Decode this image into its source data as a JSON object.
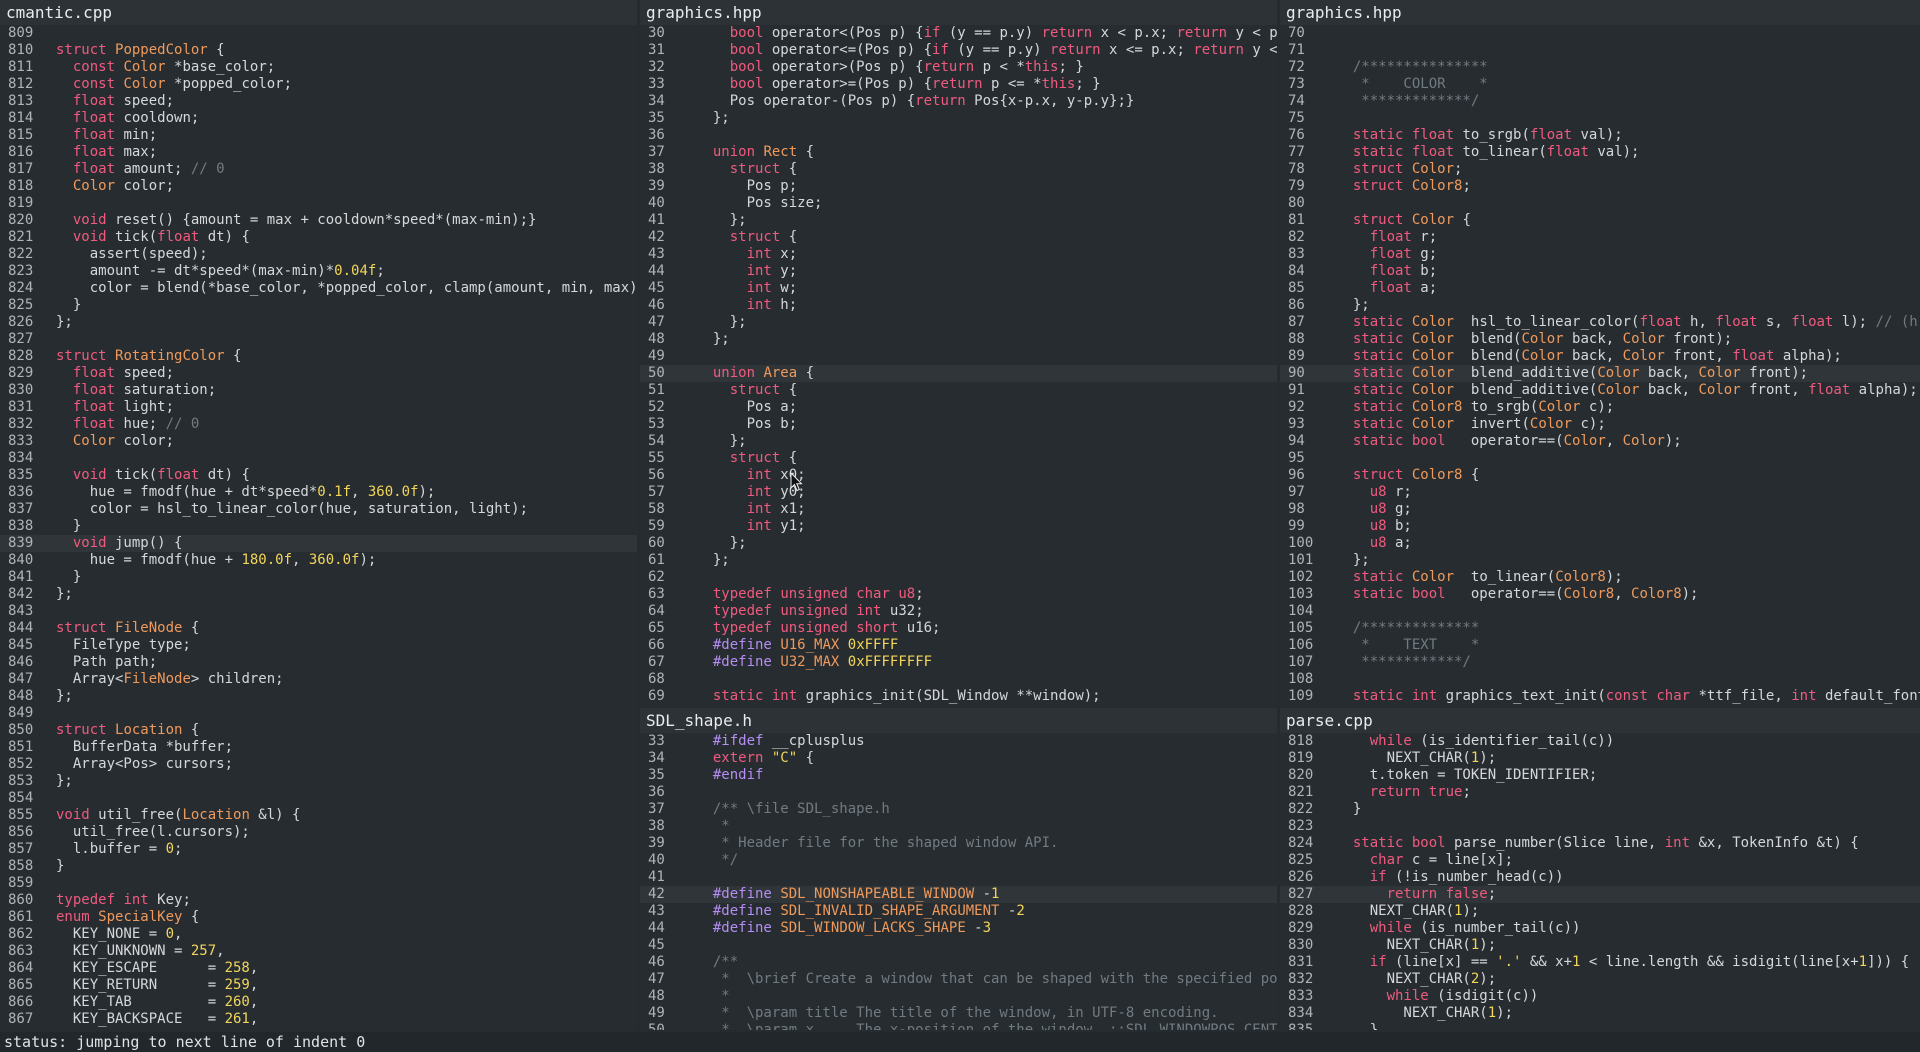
{
  "panes": [
    {
      "id": "left",
      "title": "cmantic.cpp",
      "lnw": 40,
      "lines": [
        {
          "n": "809",
          "t": ""
        },
        {
          "n": "810",
          "t": "struct PoppedColor {"
        },
        {
          "n": "811",
          "t": "  const Color *base_color;"
        },
        {
          "n": "812",
          "t": "  const Color *popped_color;"
        },
        {
          "n": "813",
          "t": "  float speed;"
        },
        {
          "n": "814",
          "t": "  float cooldown;"
        },
        {
          "n": "815",
          "t": "  float min;"
        },
        {
          "n": "816",
          "t": "  float max;"
        },
        {
          "n": "817",
          "t": "  float amount; // 0"
        },
        {
          "n": "818",
          "t": "  Color color;"
        },
        {
          "n": "819",
          "t": ""
        },
        {
          "n": "820",
          "t": "  void reset() {amount = max + cooldown*speed*(max-min);}"
        },
        {
          "n": "821",
          "t": "  void tick(float dt) {"
        },
        {
          "n": "822",
          "t": "    assert(speed);"
        },
        {
          "n": "823",
          "t": "    amount -= dt*speed*(max-min)*0.04f;"
        },
        {
          "n": "824",
          "t": "    color = blend(*base_color, *popped_color, clamp(amount, min, max));"
        },
        {
          "n": "825",
          "t": "  }"
        },
        {
          "n": "826",
          "t": "};"
        },
        {
          "n": "827",
          "t": ""
        },
        {
          "n": "828",
          "t": "struct RotatingColor {"
        },
        {
          "n": "829",
          "t": "  float speed;"
        },
        {
          "n": "830",
          "t": "  float saturation;"
        },
        {
          "n": "831",
          "t": "  float light;"
        },
        {
          "n": "832",
          "t": "  float hue; // 0"
        },
        {
          "n": "833",
          "t": "  Color color;"
        },
        {
          "n": "834",
          "t": ""
        },
        {
          "n": "835",
          "t": "  void tick(float dt) {"
        },
        {
          "n": "836",
          "t": "    hue = fmodf(hue + dt*speed*0.1f, 360.0f);"
        },
        {
          "n": "837",
          "t": "    color = hsl_to_linear_color(hue, saturation, light);"
        },
        {
          "n": "838",
          "t": "  }"
        },
        {
          "n": "839",
          "t": "  void jump() {",
          "hl": true
        },
        {
          "n": "840",
          "t": "    hue = fmodf(hue + 180.0f, 360.0f);"
        },
        {
          "n": "841",
          "t": "  }"
        },
        {
          "n": "842",
          "t": "};"
        },
        {
          "n": "843",
          "t": ""
        },
        {
          "n": "844",
          "t": "struct FileNode {"
        },
        {
          "n": "845",
          "t": "  FileType type;"
        },
        {
          "n": "846",
          "t": "  Path path;"
        },
        {
          "n": "847",
          "t": "  Array<FileNode> children;"
        },
        {
          "n": "848",
          "t": "};"
        },
        {
          "n": "849",
          "t": ""
        },
        {
          "n": "850",
          "t": "struct Location {"
        },
        {
          "n": "851",
          "t": "  BufferData *buffer;"
        },
        {
          "n": "852",
          "t": "  Array<Pos> cursors;"
        },
        {
          "n": "853",
          "t": "};"
        },
        {
          "n": "854",
          "t": ""
        },
        {
          "n": "855",
          "t": "void util_free(Location &l) {"
        },
        {
          "n": "856",
          "t": "  util_free(l.cursors);"
        },
        {
          "n": "857",
          "t": "  l.buffer = 0;"
        },
        {
          "n": "858",
          "t": "}"
        },
        {
          "n": "859",
          "t": ""
        },
        {
          "n": "860",
          "t": "typedef int Key;"
        },
        {
          "n": "861",
          "t": "enum SpecialKey {"
        },
        {
          "n": "862",
          "t": "  KEY_NONE = 0,"
        },
        {
          "n": "863",
          "t": "  KEY_UNKNOWN = 257,"
        },
        {
          "n": "864",
          "t": "  KEY_ESCAPE      = 258,"
        },
        {
          "n": "865",
          "t": "  KEY_RETURN      = 259,"
        },
        {
          "n": "866",
          "t": "  KEY_TAB         = 260,"
        },
        {
          "n": "867",
          "t": "  KEY_BACKSPACE   = 261,"
        }
      ]
    },
    {
      "id": "mid-top",
      "title": "graphics.hpp",
      "lnw": 40,
      "lines": [
        {
          "n": "30",
          "t": "    bool operator<(Pos p) {if (y == p.y) return x < p.x; return y < p.y; }"
        },
        {
          "n": "31",
          "t": "    bool operator<=(Pos p) {if (y == p.y) return x <= p.x; return y <= p.y;"
        },
        {
          "n": "32",
          "t": "    bool operator>(Pos p) {return p < *this; }"
        },
        {
          "n": "33",
          "t": "    bool operator>=(Pos p) {return p <= *this; }"
        },
        {
          "n": "34",
          "t": "    Pos operator-(Pos p) {return Pos{x-p.x, y-p.y};}"
        },
        {
          "n": "35",
          "t": "  };"
        },
        {
          "n": "36",
          "t": ""
        },
        {
          "n": "37",
          "t": "  union Rect {"
        },
        {
          "n": "38",
          "t": "    struct {"
        },
        {
          "n": "39",
          "t": "      Pos p;"
        },
        {
          "n": "40",
          "t": "      Pos size;"
        },
        {
          "n": "41",
          "t": "    };"
        },
        {
          "n": "42",
          "t": "    struct {"
        },
        {
          "n": "43",
          "t": "      int x;"
        },
        {
          "n": "44",
          "t": "      int y;"
        },
        {
          "n": "45",
          "t": "      int w;"
        },
        {
          "n": "46",
          "t": "      int h;"
        },
        {
          "n": "47",
          "t": "    };"
        },
        {
          "n": "48",
          "t": "  };"
        },
        {
          "n": "49",
          "t": ""
        },
        {
          "n": "50",
          "t": "  union Area {",
          "hl": true
        },
        {
          "n": "51",
          "t": "    struct {"
        },
        {
          "n": "52",
          "t": "      Pos a;"
        },
        {
          "n": "53",
          "t": "      Pos b;"
        },
        {
          "n": "54",
          "t": "    };"
        },
        {
          "n": "55",
          "t": "    struct {"
        },
        {
          "n": "56",
          "t": "      int x0;"
        },
        {
          "n": "57",
          "t": "      int y0;"
        },
        {
          "n": "58",
          "t": "      int x1;"
        },
        {
          "n": "59",
          "t": "      int y1;"
        },
        {
          "n": "60",
          "t": "    };"
        },
        {
          "n": "61",
          "t": "  };"
        },
        {
          "n": "62",
          "t": ""
        },
        {
          "n": "63",
          "t": "  typedef unsigned char u8;"
        },
        {
          "n": "64",
          "t": "  typedef unsigned int u32;"
        },
        {
          "n": "65",
          "t": "  typedef unsigned short u16;"
        },
        {
          "n": "66",
          "t": "  #define U16_MAX 0xFFFF"
        },
        {
          "n": "67",
          "t": "  #define U32_MAX 0xFFFFFFFF"
        },
        {
          "n": "68",
          "t": ""
        },
        {
          "n": "69",
          "t": "  static int graphics_init(SDL_Window **window);"
        }
      ]
    },
    {
      "id": "mid-bottom",
      "title": "SDL_shape.h",
      "lnw": 40,
      "lines": [
        {
          "n": "33",
          "t": "  #ifdef __cplusplus"
        },
        {
          "n": "34",
          "t": "  extern \"C\" {"
        },
        {
          "n": "35",
          "t": "  #endif"
        },
        {
          "n": "36",
          "t": ""
        },
        {
          "n": "37",
          "t": "  /** \\file SDL_shape.h"
        },
        {
          "n": "38",
          "t": "   *"
        },
        {
          "n": "39",
          "t": "   * Header file for the shaped window API."
        },
        {
          "n": "40",
          "t": "   */"
        },
        {
          "n": "41",
          "t": ""
        },
        {
          "n": "42",
          "t": "  #define SDL_NONSHAPEABLE_WINDOW -1",
          "hl": true
        },
        {
          "n": "43",
          "t": "  #define SDL_INVALID_SHAPE_ARGUMENT -2"
        },
        {
          "n": "44",
          "t": "  #define SDL_WINDOW_LACKS_SHAPE -3"
        },
        {
          "n": "45",
          "t": ""
        },
        {
          "n": "46",
          "t": "  /**"
        },
        {
          "n": "47",
          "t": "   *  \\brief Create a window that can be shaped with the specified position,"
        },
        {
          "n": "48",
          "t": "   *"
        },
        {
          "n": "49",
          "t": "   *  \\param title The title of the window, in UTF-8 encoding."
        },
        {
          "n": "50",
          "t": "   *  \\param x     The x-position of the window, ::SDL_WINDOWPOS_CENTERED, o"
        }
      ]
    },
    {
      "id": "right-top",
      "title": "graphics.hpp",
      "lnw": 40,
      "lines": [
        {
          "n": "70",
          "t": ""
        },
        {
          "n": "71",
          "t": ""
        },
        {
          "n": "72",
          "t": "  /***************"
        },
        {
          "n": "73",
          "t": "   *    COLOR    *"
        },
        {
          "n": "74",
          "t": "   *************/"
        },
        {
          "n": "75",
          "t": ""
        },
        {
          "n": "76",
          "t": "  static float to_srgb(float val);"
        },
        {
          "n": "77",
          "t": "  static float to_linear(float val);"
        },
        {
          "n": "78",
          "t": "  struct Color;"
        },
        {
          "n": "79",
          "t": "  struct Color8;"
        },
        {
          "n": "80",
          "t": ""
        },
        {
          "n": "81",
          "t": "  struct Color {"
        },
        {
          "n": "82",
          "t": "    float r;"
        },
        {
          "n": "83",
          "t": "    float g;"
        },
        {
          "n": "84",
          "t": "    float b;"
        },
        {
          "n": "85",
          "t": "    float a;"
        },
        {
          "n": "86",
          "t": "  };"
        },
        {
          "n": "87",
          "t": "  static Color  hsl_to_linear_color(float h, float s, float l); // (h,s,v)"
        },
        {
          "n": "88",
          "t": "  static Color  blend(Color back, Color front);"
        },
        {
          "n": "89",
          "t": "  static Color  blend(Color back, Color front, float alpha);"
        },
        {
          "n": "90",
          "t": "  static Color  blend_additive(Color back, Color front);",
          "hl": true
        },
        {
          "n": "91",
          "t": "  static Color  blend_additive(Color back, Color front, float alpha);"
        },
        {
          "n": "92",
          "t": "  static Color8 to_srgb(Color c);"
        },
        {
          "n": "93",
          "t": "  static Color  invert(Color c);"
        },
        {
          "n": "94",
          "t": "  static bool   operator==(Color, Color);"
        },
        {
          "n": "95",
          "t": ""
        },
        {
          "n": "96",
          "t": "  struct Color8 {"
        },
        {
          "n": "97",
          "t": "    u8 r;"
        },
        {
          "n": "98",
          "t": "    u8 g;"
        },
        {
          "n": "99",
          "t": "    u8 b;"
        },
        {
          "n": "100",
          "t": "    u8 a;"
        },
        {
          "n": "101",
          "t": "  };"
        },
        {
          "n": "102",
          "t": "  static Color  to_linear(Color8);"
        },
        {
          "n": "103",
          "t": "  static bool   operator==(Color8, Color8);"
        },
        {
          "n": "104",
          "t": ""
        },
        {
          "n": "105",
          "t": "  /**************"
        },
        {
          "n": "106",
          "t": "   *    TEXT    *"
        },
        {
          "n": "107",
          "t": "   ************/"
        },
        {
          "n": "108",
          "t": ""
        },
        {
          "n": "109",
          "t": "  static int graphics_text_init(const char *ttf_file, int default_font_size"
        }
      ]
    },
    {
      "id": "right-bottom",
      "title": "parse.cpp",
      "lnw": 40,
      "lines": [
        {
          "n": "818",
          "t": "    while (is_identifier_tail(c))"
        },
        {
          "n": "819",
          "t": "      NEXT_CHAR(1);"
        },
        {
          "n": "820",
          "t": "    t.token = TOKEN_IDENTIFIER;"
        },
        {
          "n": "821",
          "t": "    return true;"
        },
        {
          "n": "822",
          "t": "  }"
        },
        {
          "n": "823",
          "t": ""
        },
        {
          "n": "824",
          "t": "  static bool parse_number(Slice line, int &x, TokenInfo &t) {"
        },
        {
          "n": "825",
          "t": "    char c = line[x];"
        },
        {
          "n": "826",
          "t": "    if (!is_number_head(c))"
        },
        {
          "n": "827",
          "t": "      return false;",
          "hl": true
        },
        {
          "n": "828",
          "t": "    NEXT_CHAR(1);"
        },
        {
          "n": "829",
          "t": "    while (is_number_tail(c))"
        },
        {
          "n": "830",
          "t": "      NEXT_CHAR(1);"
        },
        {
          "n": "831",
          "t": "    if (line[x] == '.' && x+1 < line.length && isdigit(line[x+1])) {"
        },
        {
          "n": "832",
          "t": "      NEXT_CHAR(2);"
        },
        {
          "n": "833",
          "t": "      while (isdigit(c))"
        },
        {
          "n": "834",
          "t": "        NEXT_CHAR(1);"
        },
        {
          "n": "835",
          "t": "    }"
        }
      ]
    }
  ],
  "status": {
    "text": "status: jumping to next line of indent 0"
  },
  "colors": {
    "background": "#272c30",
    "keyword": "#ef5b7f",
    "type": "#ef9a5c",
    "number": "#f2d65a",
    "comment": "#717b82",
    "preprocessor": "#b48ef2",
    "plain": "#d5d8da"
  },
  "icons": {
    "mouse": "mouse-pointer-icon"
  }
}
